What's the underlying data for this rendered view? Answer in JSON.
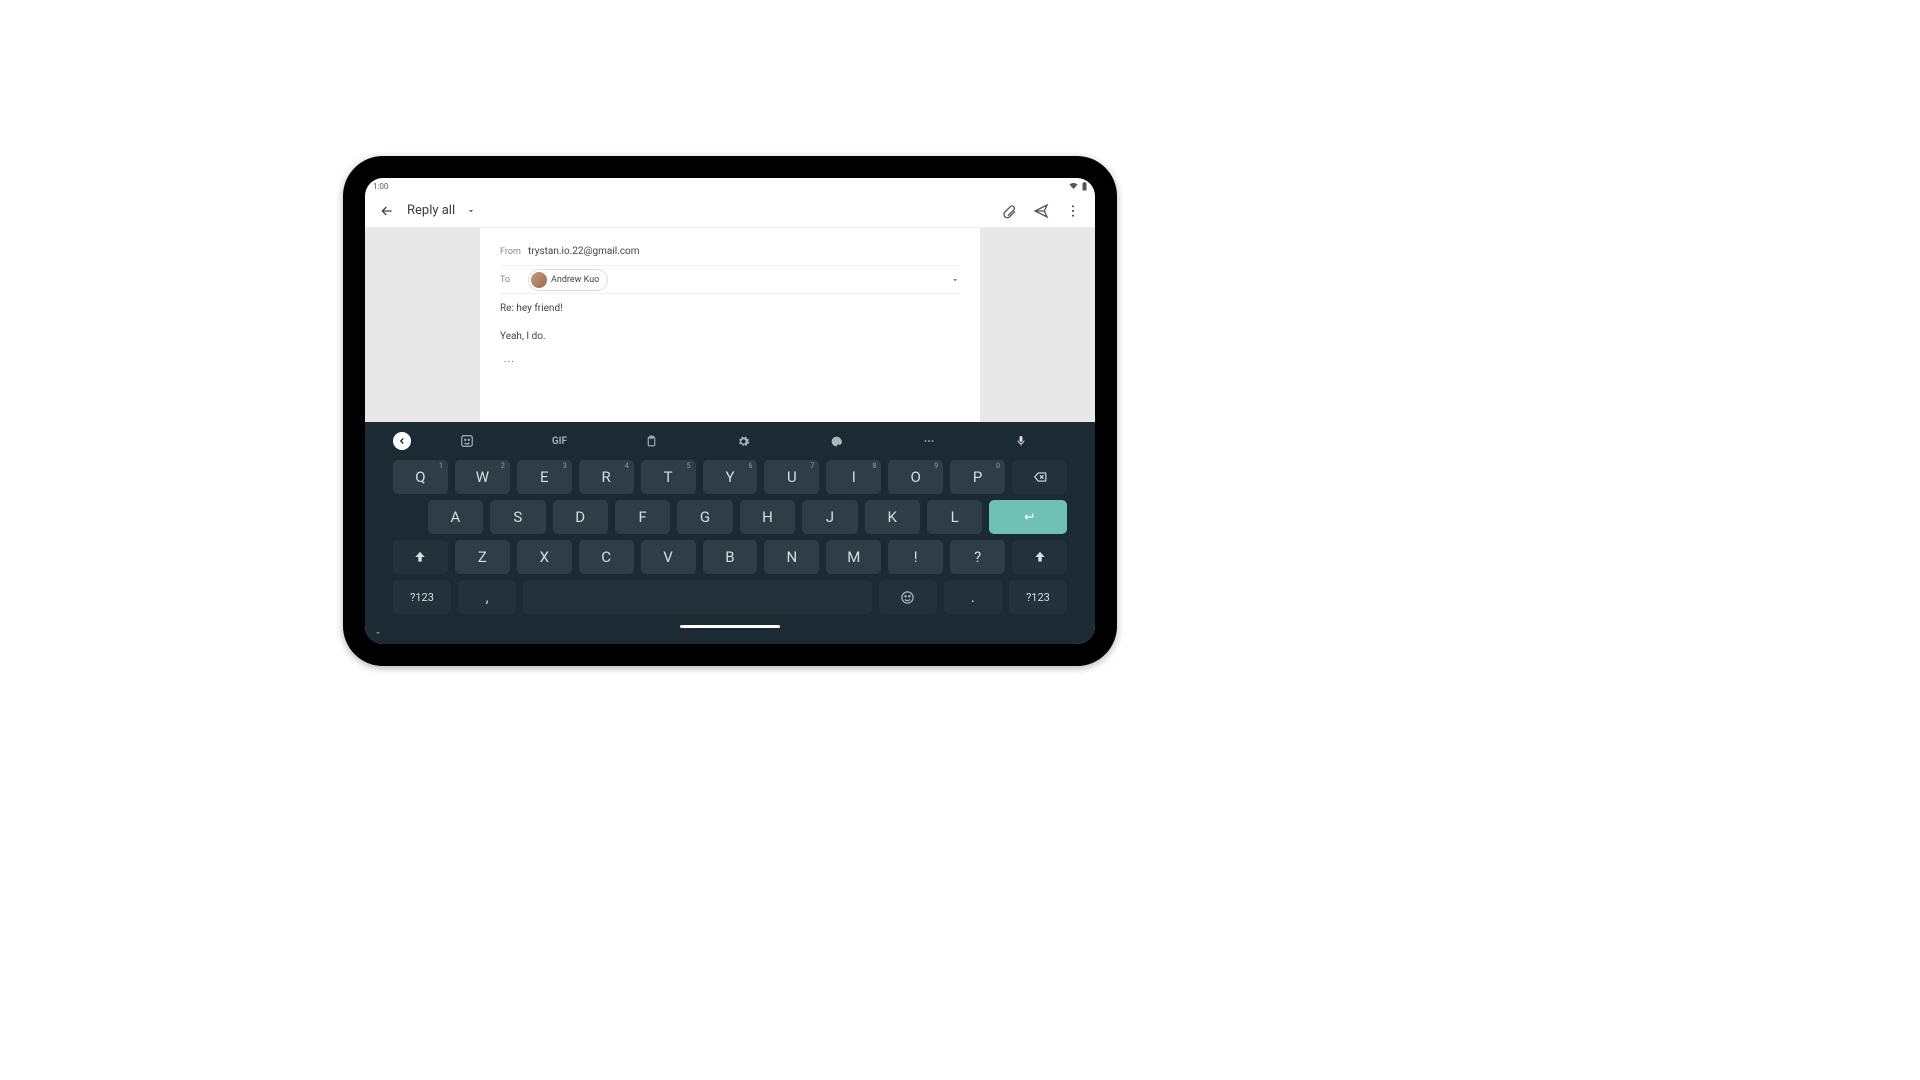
{
  "statusbar": {
    "time": "1:00"
  },
  "appbar": {
    "title": "Reply all"
  },
  "compose": {
    "from_label": "From",
    "from_value": "trystan.io.22@gmail.com",
    "to_label": "To",
    "to_chip": "Andrew Kuo",
    "subject": "Re: hey friend!",
    "body_text": "Yeah, I do.",
    "ellipsis": "..."
  },
  "keyboard": {
    "gif": "GIF",
    "row1": [
      {
        "k": "Q",
        "h": "1"
      },
      {
        "k": "W",
        "h": "2"
      },
      {
        "k": "E",
        "h": "3"
      },
      {
        "k": "R",
        "h": "4"
      },
      {
        "k": "T",
        "h": "5"
      },
      {
        "k": "Y",
        "h": "6"
      },
      {
        "k": "U",
        "h": "7"
      },
      {
        "k": "I",
        "h": "8"
      },
      {
        "k": "O",
        "h": "9"
      },
      {
        "k": "P",
        "h": "0"
      }
    ],
    "row2": [
      "A",
      "S",
      "D",
      "F",
      "G",
      "H",
      "J",
      "K",
      "L"
    ],
    "row3": [
      "Z",
      "X",
      "C",
      "V",
      "B",
      "N",
      "M",
      "!",
      "?"
    ],
    "sym": "?123",
    "comma": ",",
    "period": "."
  }
}
